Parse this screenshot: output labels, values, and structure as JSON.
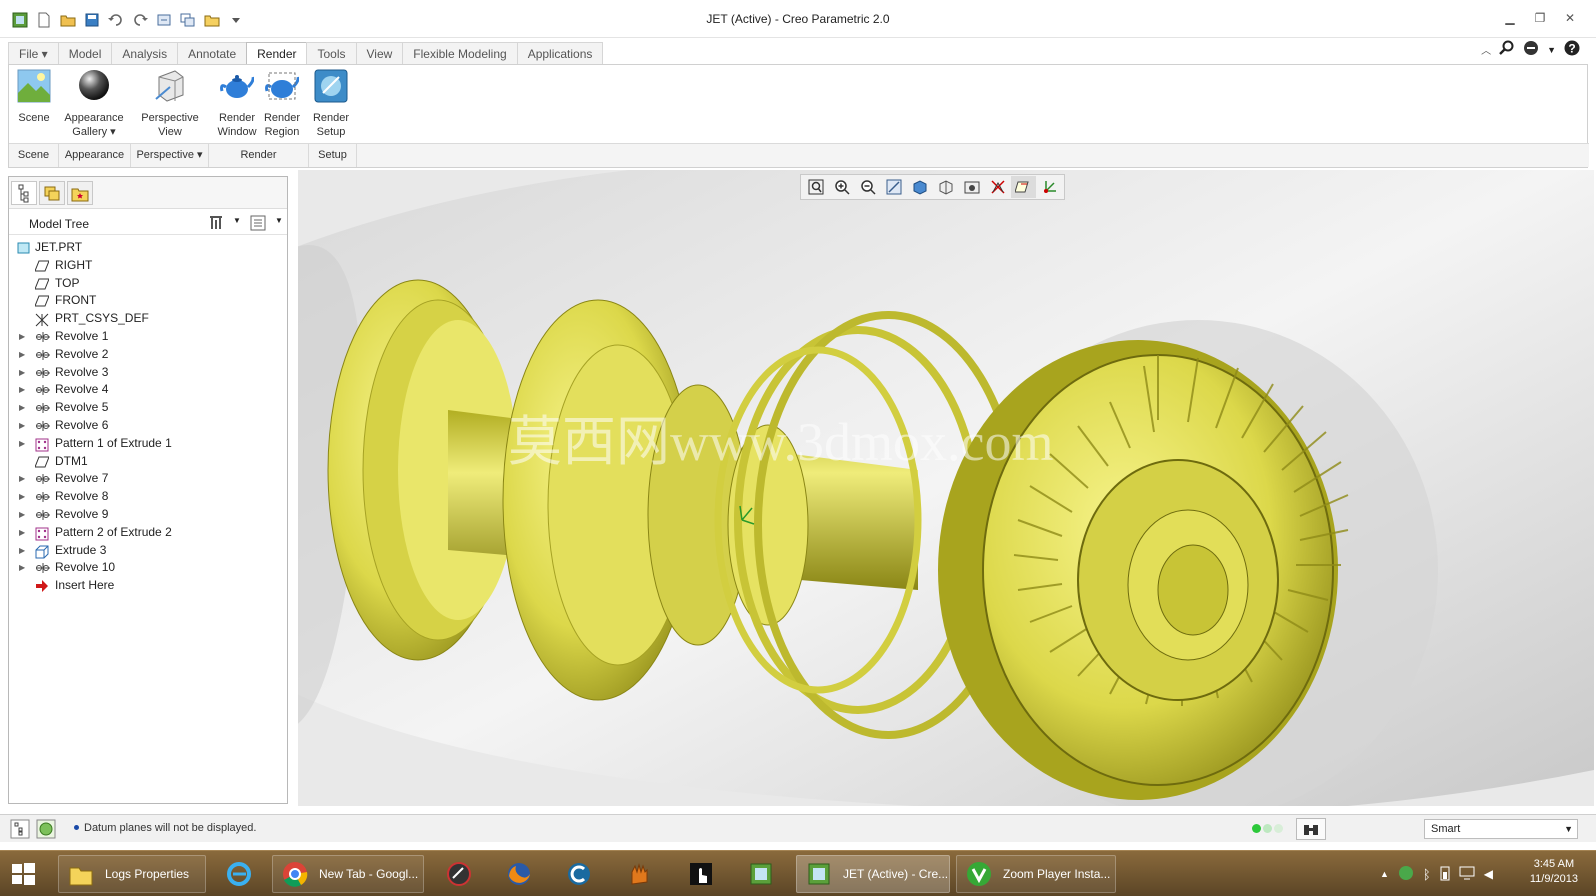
{
  "window": {
    "title": "JET (Active) - Creo Parametric 2.0"
  },
  "ribbon": {
    "tabs": [
      "File",
      "Model",
      "Analysis",
      "Annotate",
      "Render",
      "Tools",
      "View",
      "Flexible Modeling",
      "Applications"
    ],
    "active_tab": "Render",
    "buttons": {
      "scene": "Scene",
      "appearance_1": "Appearance",
      "appearance_2": "Gallery",
      "perspective_1": "Perspective",
      "perspective_2": "View",
      "render_window_1": "Render",
      "render_window_2": "Window",
      "render_region_1": "Render",
      "render_region_2": "Region",
      "render_setup_1": "Render",
      "render_setup_2": "Setup"
    },
    "groups": [
      "Scene",
      "Appearance",
      "Perspective",
      "Render",
      "Setup"
    ]
  },
  "model_tree": {
    "title": "Model Tree",
    "items": [
      {
        "label": "JET.PRT",
        "icon": "part-icon",
        "expandable": false
      },
      {
        "label": "RIGHT",
        "icon": "datum-plane-icon",
        "expandable": false
      },
      {
        "label": "TOP",
        "icon": "datum-plane-icon",
        "expandable": false
      },
      {
        "label": "FRONT",
        "icon": "datum-plane-icon",
        "expandable": false
      },
      {
        "label": "PRT_CSYS_DEF",
        "icon": "csys-icon",
        "expandable": false
      },
      {
        "label": "Revolve 1",
        "icon": "revolve-icon",
        "expandable": true
      },
      {
        "label": "Revolve 2",
        "icon": "revolve-icon",
        "expandable": true
      },
      {
        "label": "Revolve 3",
        "icon": "revolve-icon",
        "expandable": true
      },
      {
        "label": "Revolve 4",
        "icon": "revolve-icon",
        "expandable": true
      },
      {
        "label": "Revolve 5",
        "icon": "revolve-icon",
        "expandable": true
      },
      {
        "label": "Revolve 6",
        "icon": "revolve-icon",
        "expandable": true
      },
      {
        "label": "Pattern 1 of Extrude 1",
        "icon": "pattern-icon",
        "expandable": true
      },
      {
        "label": "DTM1",
        "icon": "datum-plane-icon",
        "expandable": false
      },
      {
        "label": "Revolve 7",
        "icon": "revolve-icon",
        "expandable": true
      },
      {
        "label": "Revolve 8",
        "icon": "revolve-icon",
        "expandable": true
      },
      {
        "label": "Revolve 9",
        "icon": "revolve-icon",
        "expandable": true
      },
      {
        "label": "Pattern 2 of Extrude 2",
        "icon": "pattern-icon",
        "expandable": true
      },
      {
        "label": "Extrude 3",
        "icon": "extrude-icon",
        "expandable": true
      },
      {
        "label": "Revolve 10",
        "icon": "revolve-icon",
        "expandable": true
      },
      {
        "label": "Insert Here",
        "icon": "insert-arrow-icon",
        "expandable": false
      }
    ]
  },
  "viewport": {
    "watermark": "莫西网www.3dmox.com",
    "model_color": "#e3e05a"
  },
  "status": {
    "message": "Datum planes will not be displayed.",
    "filter": "Smart"
  },
  "taskbar": {
    "items": [
      {
        "label": "Logs Properties",
        "icon": "folder-icon"
      },
      {
        "label": "",
        "icon": "internet-explorer-icon"
      },
      {
        "label": "New Tab - Googl...",
        "icon": "chrome-icon"
      },
      {
        "label": "",
        "icon": "recorder-icon"
      },
      {
        "label": "",
        "icon": "firefox-icon"
      },
      {
        "label": "",
        "icon": "c-app-icon"
      },
      {
        "label": "",
        "icon": "glove-icon"
      },
      {
        "label": "",
        "icon": "hand-pointer-icon"
      },
      {
        "label": "",
        "icon": "creo-icon"
      },
      {
        "label": "JET (Active) - Cre...",
        "icon": "creo-icon"
      },
      {
        "label": "Zoom Player Insta...",
        "icon": "zoom-player-icon"
      }
    ],
    "time": "3:45 AM",
    "date": "11/9/2013"
  }
}
